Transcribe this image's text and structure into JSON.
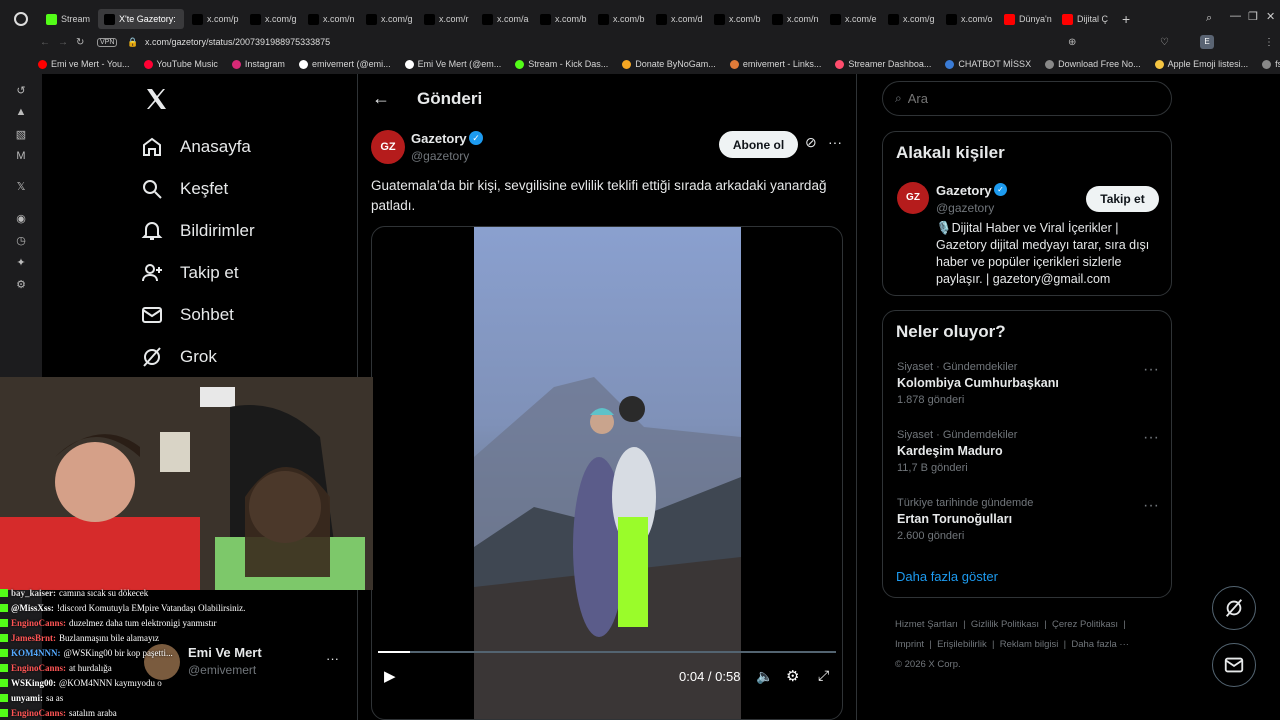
{
  "browser": {
    "tabs": [
      {
        "label": "Stream",
        "color": "#53fc18"
      },
      {
        "label": "X'te Gazetory:",
        "color": "#000000"
      },
      {
        "label": "x.com/p",
        "color": "#000000"
      },
      {
        "label": "x.com/g",
        "color": "#000000"
      },
      {
        "label": "x.com/n",
        "color": "#000000"
      },
      {
        "label": "x.com/g",
        "color": "#000000"
      },
      {
        "label": "x.com/r",
        "color": "#000000"
      },
      {
        "label": "x.com/a",
        "color": "#000000"
      },
      {
        "label": "x.com/b",
        "color": "#000000"
      },
      {
        "label": "x.com/b",
        "color": "#000000"
      },
      {
        "label": "x.com/d",
        "color": "#000000"
      },
      {
        "label": "x.com/b",
        "color": "#000000"
      },
      {
        "label": "x.com/n",
        "color": "#000000"
      },
      {
        "label": "x.com/e",
        "color": "#000000"
      },
      {
        "label": "x.com/g",
        "color": "#000000"
      },
      {
        "label": "x.com/o",
        "color": "#000000"
      },
      {
        "label": "Dünya'n",
        "color": "#ff0000"
      },
      {
        "label": "Dijital Ç",
        "color": "#ff0000"
      }
    ],
    "vpn": "VPN",
    "url": "x.com/gazetory/status/2007391988975333875",
    "bookmarks": [
      {
        "label": "Emi ve Mert - You...",
        "color": "#ff0000"
      },
      {
        "label": "YouTube Music",
        "color": "#ff0033"
      },
      {
        "label": "Instagram",
        "color": "#d62976"
      },
      {
        "label": "emivemert (@emi...",
        "color": "#ffffff"
      },
      {
        "label": "Emi Ve Mert (@em...",
        "color": "#ffffff"
      },
      {
        "label": "Stream - Kick Das...",
        "color": "#53fc18"
      },
      {
        "label": "Donate ByNoGam...",
        "color": "#f5a623"
      },
      {
        "label": "emivemert - Links...",
        "color": "#e07b39"
      },
      {
        "label": "Streamer Dashboa...",
        "color": "#ff4d6d"
      },
      {
        "label": "CHATBOT MİSSX",
        "color": "#3a7bd5"
      },
      {
        "label": "Download Free No...",
        "color": "#888888"
      },
      {
        "label": "Apple Emoji listesi...",
        "color": "#f5c542"
      },
      {
        "label": "fsfsd",
        "color": "#888888"
      }
    ]
  },
  "nav": {
    "items": [
      {
        "label": "Anasayfa"
      },
      {
        "label": "Keşfet"
      },
      {
        "label": "Bildirimler"
      },
      {
        "label": "Takip et"
      },
      {
        "label": "Sohbet"
      },
      {
        "label": "Grok"
      }
    ]
  },
  "header": {
    "title": "Gönderi"
  },
  "post": {
    "author_name": "Gazetory",
    "author_handle": "@gazetory",
    "avatar_text": "GZ",
    "subscribe_label": "Abone ol",
    "text": "Guatemala’da bir kişi, sevgilisine evlilik teklifi ettiği sırada arkadaki yanardağ patladı.",
    "video_time": "0:04 / 0:58",
    "video_progress": 0.069
  },
  "account_switcher": {
    "name": "Emi Ve Mert",
    "handle": "@emivemert"
  },
  "search": {
    "placeholder": "Ara"
  },
  "related": {
    "title": "Alakalı kişiler",
    "name": "Gazetory",
    "handle": "@gazetory",
    "follow_label": "Takip et",
    "bio": "🎙️Dijital Haber ve Viral İçerikler | Gazetory dijital medyayı tarar, sıra dışı haber ve popüler içerikleri sizlerle paylaşır. | gazetory@gmail.com"
  },
  "trends": {
    "title": "Neler oluyor?",
    "items": [
      {
        "context": "Siyaset · Gündemdekiler",
        "name": "Kolombiya Cumhurbaşkanı",
        "count": "1.878 gönderi"
      },
      {
        "context": "Siyaset · Gündemdekiler",
        "name": "Kardeşim Maduro",
        "count": "11,7 B gönderi"
      },
      {
        "context": "Türkiye tarihinde gündemde",
        "name": "Ertan Torunoğulları",
        "count": "2.600 gönderi"
      }
    ],
    "show_more": "Daha fazla göster"
  },
  "footer": {
    "links": [
      "Hizmet Şartları",
      "Gizlilik Politikası",
      "Çerez Politikası",
      "Imprint",
      "Erişilebilirlik",
      "Reklam bilgisi",
      "Daha fazla ···"
    ],
    "copyright": "© 2026 X Corp."
  },
  "chat": {
    "messages": [
      {
        "user": "bay_kaiser:",
        "text": "camına sıcak su dökecek"
      },
      {
        "user": "@MissXss:",
        "text": "!discord Komutuyla EMpire Vatandaşı Olabilirsiniz."
      },
      {
        "user": "EnginoCanns:",
        "text": "duzelmez daha tum elektronigi yanmıstır"
      },
      {
        "user": "JamesBrnt:",
        "text": "Buzlanmaşını bile alamayız"
      },
      {
        "user": "KOM4NNN:",
        "text": "@WSKing00 bir kop paşetti..."
      },
      {
        "user": "EnginoCanns:",
        "text": "at hurdalığa"
      },
      {
        "user": "WSKing00:",
        "text": "@KOM4NNN kaymıyodu o"
      },
      {
        "user": "unyami:",
        "text": "sa as"
      },
      {
        "user": "EnginoCanns:",
        "text": "satalım araba"
      }
    ]
  }
}
